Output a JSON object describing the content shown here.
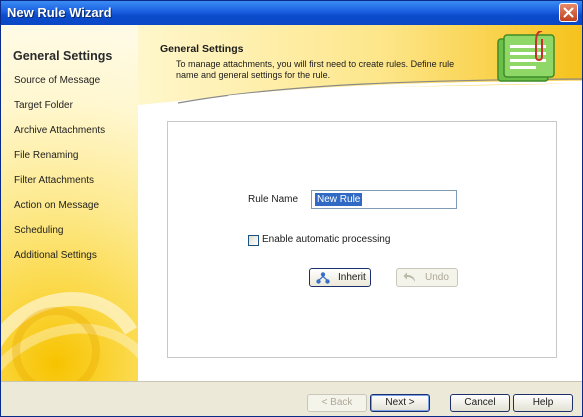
{
  "window": {
    "title": "New Rule Wizard"
  },
  "sidebar": {
    "heading": "General Settings",
    "items": [
      {
        "label": "Source of Message"
      },
      {
        "label": "Target Folder"
      },
      {
        "label": "Archive Attachments"
      },
      {
        "label": "File Renaming"
      },
      {
        "label": "Filter Attachments"
      },
      {
        "label": "Action on Message"
      },
      {
        "label": "Scheduling"
      },
      {
        "label": "Additional Settings"
      }
    ]
  },
  "header": {
    "title": "General Settings",
    "description": "To manage attachments, you will first need to create rules. Define rule name and general settings for the rule."
  },
  "form": {
    "rule_name_label": "Rule Name",
    "rule_name_value": "New Rule",
    "auto_processing_label": "Enable automatic processing",
    "auto_processing_checked": false,
    "inherit_label": "Inherit",
    "undo_label": "Undo"
  },
  "footer": {
    "back_label": "< Back",
    "next_label": "Next >",
    "cancel_label": "Cancel",
    "help_label": "Help"
  },
  "colors": {
    "title_bar": "#0a47c6",
    "sidebar_accent": "#f7c300",
    "selection": "#316ac5"
  },
  "icons": {
    "close": "close-icon",
    "inherit": "inherit-icon",
    "undo": "undo-icon",
    "header_graphic": "attachment-document-icon"
  }
}
